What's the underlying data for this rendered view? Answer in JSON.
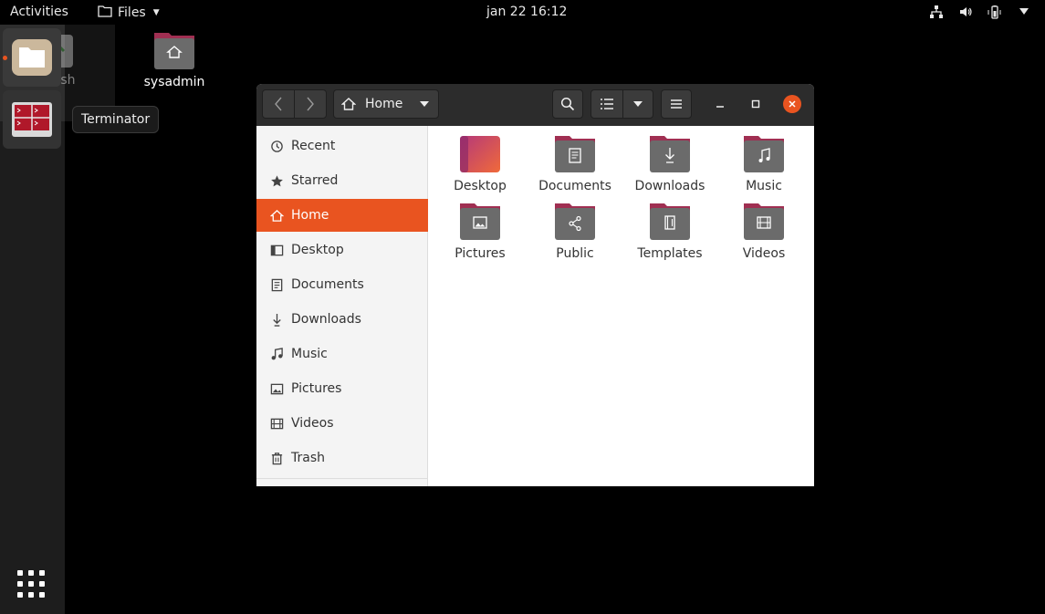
{
  "topbar": {
    "activities": "Activities",
    "app_menu": "Files",
    "clock": "jan 22  16:12"
  },
  "dock": {
    "tooltip": "Terminator"
  },
  "desktop": {
    "trash_label": "Trash",
    "home_label": "sysadmin"
  },
  "window": {
    "path_label": "Home",
    "sidebar": [
      {
        "label": "Recent",
        "icon": "clock-icon"
      },
      {
        "label": "Starred",
        "icon": "star-icon"
      },
      {
        "label": "Home",
        "icon": "home-icon",
        "active": true
      },
      {
        "label": "Desktop",
        "icon": "desktop-icon"
      },
      {
        "label": "Documents",
        "icon": "document-icon"
      },
      {
        "label": "Downloads",
        "icon": "download-icon"
      },
      {
        "label": "Music",
        "icon": "music-icon"
      },
      {
        "label": "Pictures",
        "icon": "picture-icon"
      },
      {
        "label": "Videos",
        "icon": "video-icon"
      },
      {
        "label": "Trash",
        "icon": "trash-icon"
      }
    ],
    "folders": [
      {
        "label": "Desktop",
        "icon": "desktop-folder-icon"
      },
      {
        "label": "Documents",
        "icon": "documents-folder-icon"
      },
      {
        "label": "Downloads",
        "icon": "downloads-folder-icon"
      },
      {
        "label": "Music",
        "icon": "music-folder-icon"
      },
      {
        "label": "Pictures",
        "icon": "pictures-folder-icon"
      },
      {
        "label": "Public",
        "icon": "public-folder-icon"
      },
      {
        "label": "Templates",
        "icon": "templates-folder-icon"
      },
      {
        "label": "Videos",
        "icon": "videos-folder-icon"
      }
    ]
  },
  "colors": {
    "accent": "#e95420",
    "folder_tab": "#a02f52",
    "folder_body": "#6b6b6b"
  }
}
